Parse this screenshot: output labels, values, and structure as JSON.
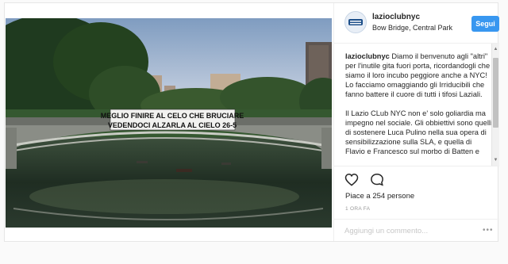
{
  "post": {
    "username": "lazioclubnyc",
    "location": "Bow Bridge, Central Park",
    "follow_label": "Segui",
    "banner": {
      "line1": "MEGLIO FINIRE AL CELO CHE BRUCIARE",
      "line2": "VEDENDOCI ALZARLA AL CIELO  26-5"
    },
    "caption": {
      "author": "lazioclubnyc",
      "paragraph1": " Diamo il benvenuto agli \"altri\" per l'inutile gita fuori porta, ricordandogli che siamo il loro incubo peggiore anche a NYC! Lo facciamo omaggiando gli Irriducibili che fanno battere il cuore di tutti i tifosi Laziali.",
      "paragraph2": "Il Lazio CLub NYC non e' solo goliardia ma impegno nel sociale. Gli obbiettivi sono quelli di sostenere Luca Pulino nella sua opera di sensibilizzazione sulla SLA, e quella di Flavio e Francesco sul morbo di Batten e"
    },
    "likes": "Piace a 254 persone",
    "time": "1 ORA FA",
    "comment_placeholder": "Aggiungi un commento...",
    "more_icon": "•••",
    "icons": [
      "heart-icon",
      "comment-bubble-icon",
      "more-options-icon"
    ]
  }
}
